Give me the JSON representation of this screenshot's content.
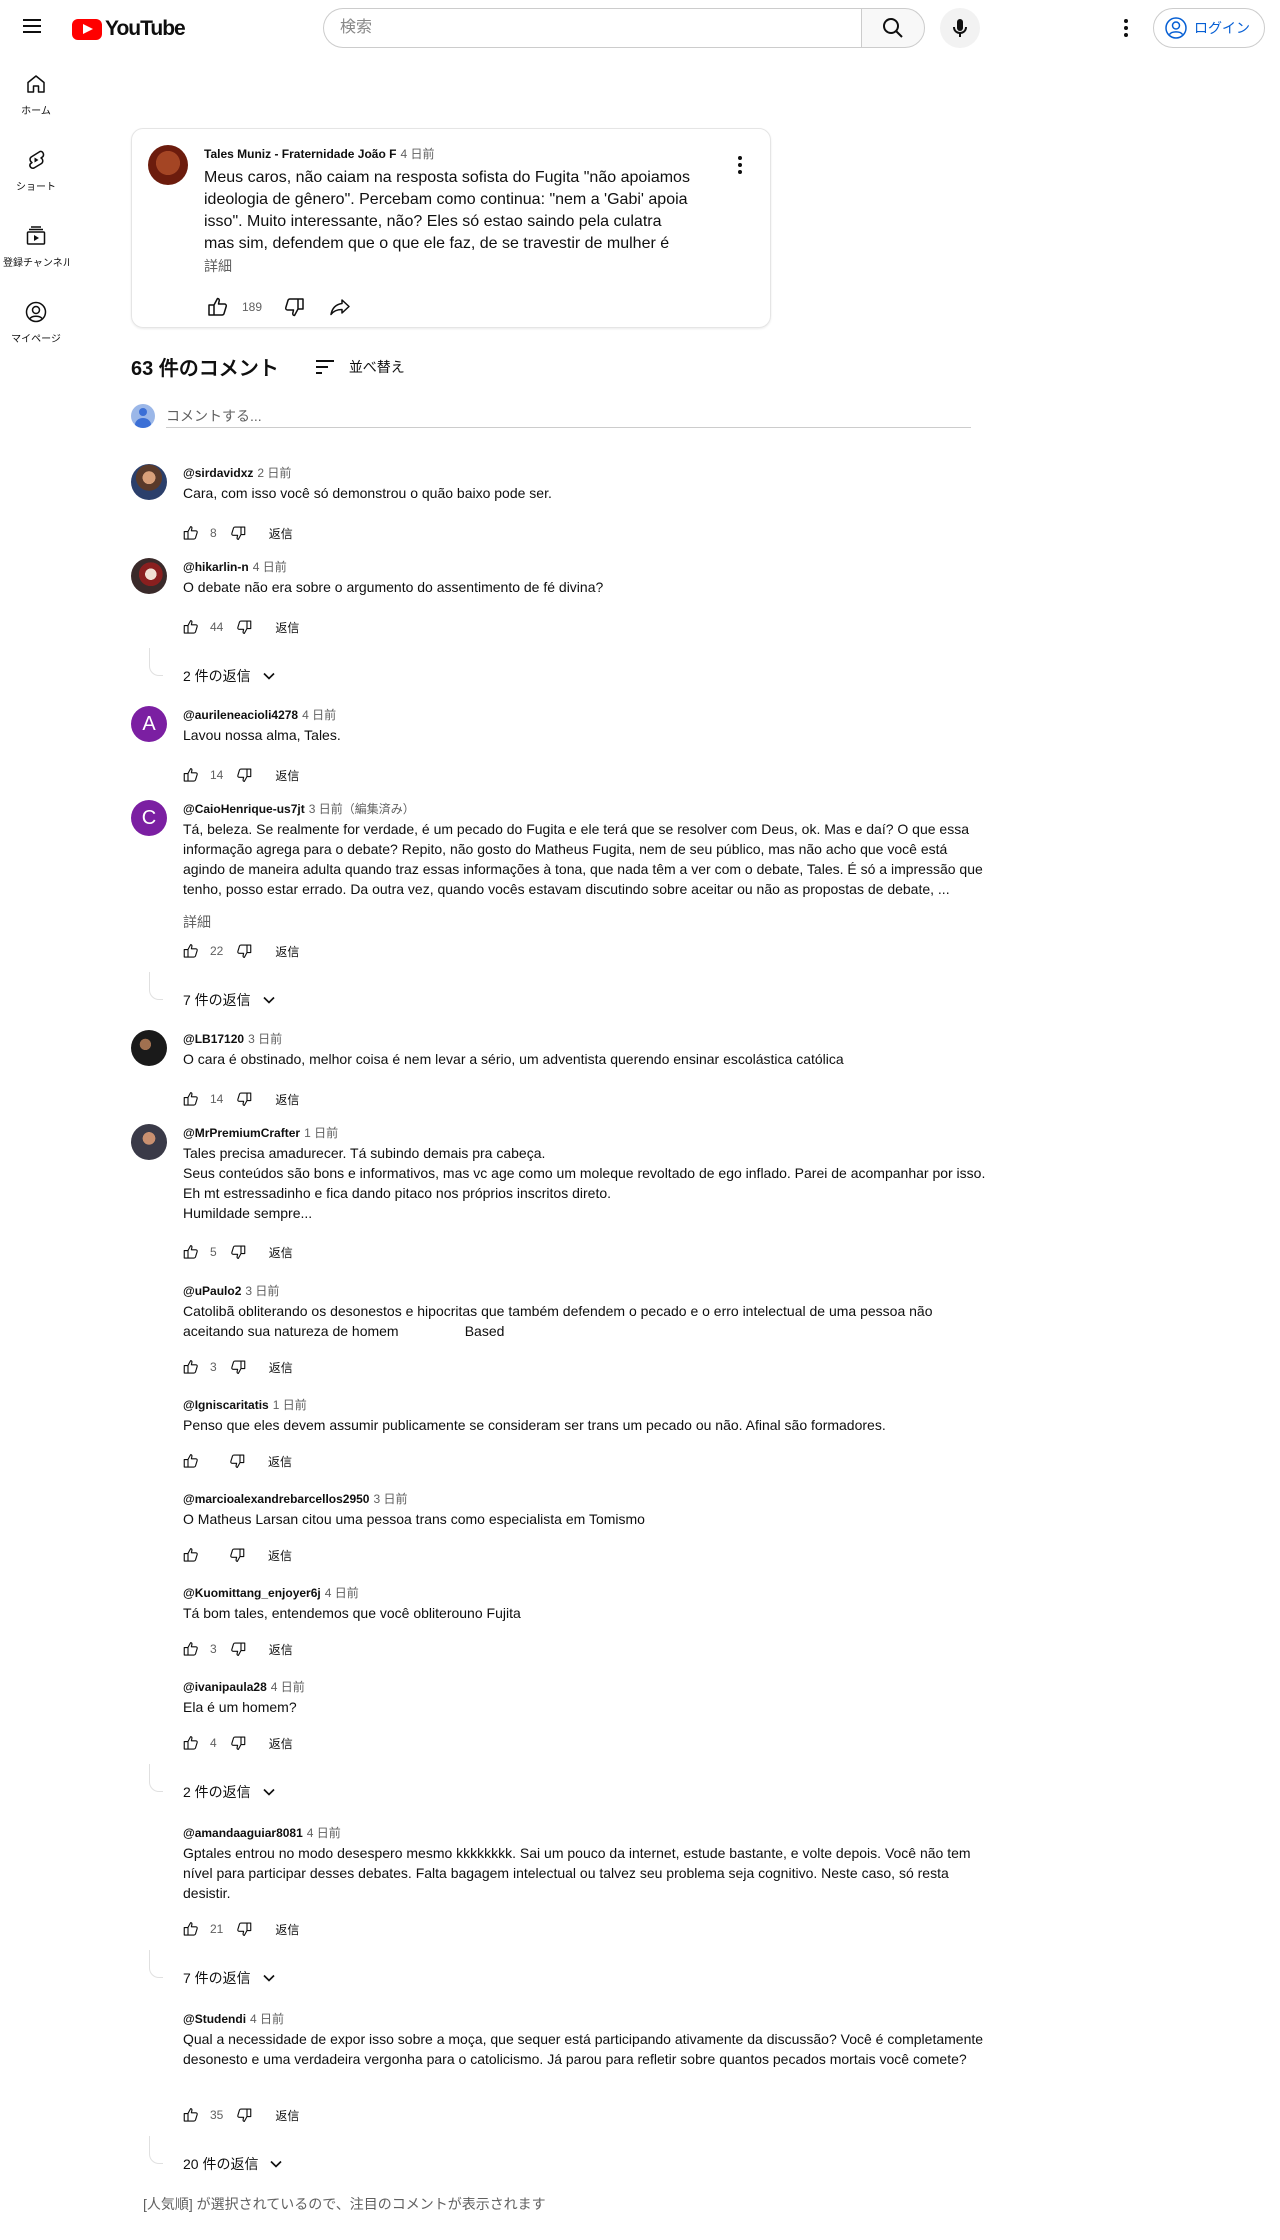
{
  "header": {
    "logo_text": "YouTube",
    "search_placeholder": "検索",
    "login_label": "ログイン"
  },
  "sidebar": {
    "items": [
      {
        "label": "ホーム"
      },
      {
        "label": "ショート"
      },
      {
        "label": "登録チャンネル"
      },
      {
        "label": "マイページ"
      }
    ]
  },
  "post": {
    "author": "Tales Muniz - Fraternidade João F",
    "time": "4 日前",
    "body": "Meus caros, não caiam na resposta sofista do Fugita \"não apoiamos ideologia de gênero\". Percebam como continua: \"nem a 'Gabi' apoia isso\". Muito interessante, não? Eles só estao saindo pela culatra mas sim, defendem que o que ele faz, de se travestir de mulher é correto. ...",
    "more_label": "詳細",
    "likes": "189"
  },
  "comments_section": {
    "count_label": "63 件のコメント",
    "sort_label": "並べ替え",
    "add_placeholder": "コメントする...",
    "reply_label": "返信",
    "footer_note": "[人気順] が選択されているので、注目のコメントが表示されます"
  },
  "comments": [
    {
      "user": "@sirdavidxz",
      "time": "2 日前",
      "text": "Cara, com isso você só demonstrou o quão baixo pode ser.",
      "likes": "8",
      "replies": ""
    },
    {
      "user": "@hikarlin-n",
      "time": "4 日前",
      "text": "O debate não era sobre o argumento do assentimento de fé divina?",
      "likes": "44",
      "replies": "2 件の返信"
    },
    {
      "user": "@aurileneacioli4278",
      "time": "4 日前",
      "text": "Lavou nossa alma, Tales.",
      "likes": "14",
      "replies": "",
      "initial": "A"
    },
    {
      "user": "@CaioHenrique-us7jt",
      "time": "3 日前（編集済み）",
      "text": "Tá, beleza. Se realmente for verdade, é um pecado do Fugita e ele terá que se resolver com Deus, ok. Mas e daí? O que essa informação agrega para o debate? Repito, não gosto do Matheus Fugita, nem de seu público, mas não acho que você está agindo de maneira adulta quando traz essas informações à tona, que nada têm a ver com o debate, Tales. É só a impressão que tenho, posso estar errado. Da outra vez, quando vocês estavam discutindo sobre aceitar ou não as propostas de debate, ...",
      "likes": "22",
      "replies": "7 件の返信",
      "initial": "C",
      "more": "詳細"
    },
    {
      "user": "@LB17120",
      "time": "3 日前",
      "text": "O cara é obstinado, melhor coisa é nem levar a sério, um adventista querendo ensinar escolástica católica",
      "likes": "14",
      "replies": ""
    },
    {
      "user": "@MrPremiumCrafter",
      "time": "1 日前",
      "text": "Tales precisa amadurecer. Tá subindo demais pra cabeça.\nSeus conteúdos são bons e informativos, mas vc age como um moleque revoltado de ego inflado. Parei de acompanhar por isso. Eh mt estressadinho e fica dando pitaco nos próprios inscritos direto.\nHumildade sempre...",
      "likes": "5",
      "replies": ""
    },
    {
      "user": "@uPaulo2",
      "time": "3 日前",
      "text": "Catolibã obliterando os desonestos e hipocritas que também defendem o pecado e o erro intelectual de uma pessoa não aceitando sua natureza de homem                 Based",
      "likes": "3",
      "replies": ""
    },
    {
      "user": "@Igniscaritatis",
      "time": "1 日前",
      "text": "Penso que eles devem assumir publicamente se consideram ser trans um pecado ou não. Afinal são formadores.",
      "likes": "",
      "replies": ""
    },
    {
      "user": "@marcioalexandrebarcellos2950",
      "time": "3 日前",
      "text": "O Matheus Larsan citou uma pessoa trans como especialista em Tomismo",
      "likes": "",
      "replies": ""
    },
    {
      "user": "@Kuomittang_enjoyer6j",
      "time": "4 日前",
      "text": "Tá bom tales, entendemos que você obliterouno Fujita",
      "likes": "3",
      "replies": ""
    },
    {
      "user": "@ivanipaula28",
      "time": "4 日前",
      "text": "Ela é um homem?",
      "likes": "4",
      "replies": "2 件の返信"
    },
    {
      "user": "@amandaaguiar8081",
      "time": "4 日前",
      "text": "Gptales entrou no modo desespero mesmo kkkkkkkk. Sai um pouco da internet, estude bastante, e volte depois. Você não tem nível para participar desses debates. Falta bagagem intelectual ou talvez seu problema seja cognitivo. Neste caso, só resta desistir.",
      "likes": "21",
      "replies": "7 件の返信"
    },
    {
      "user": "@Studendi",
      "time": "4 日前",
      "text": "Qual a necessidade de expor isso sobre a moça, que sequer está participando ativamente da discussão? Você é completamente desonesto e uma verdadeira vergonha para o catolicismo. Já parou para refletir sobre quantos pecados mortais você comete?",
      "likes": "35",
      "replies": "20 件の返信"
    }
  ],
  "colors": {
    "accent_blue": "#065fd4",
    "brand_red": "#ff0000",
    "avatar_purple": "#7b1fa2"
  }
}
